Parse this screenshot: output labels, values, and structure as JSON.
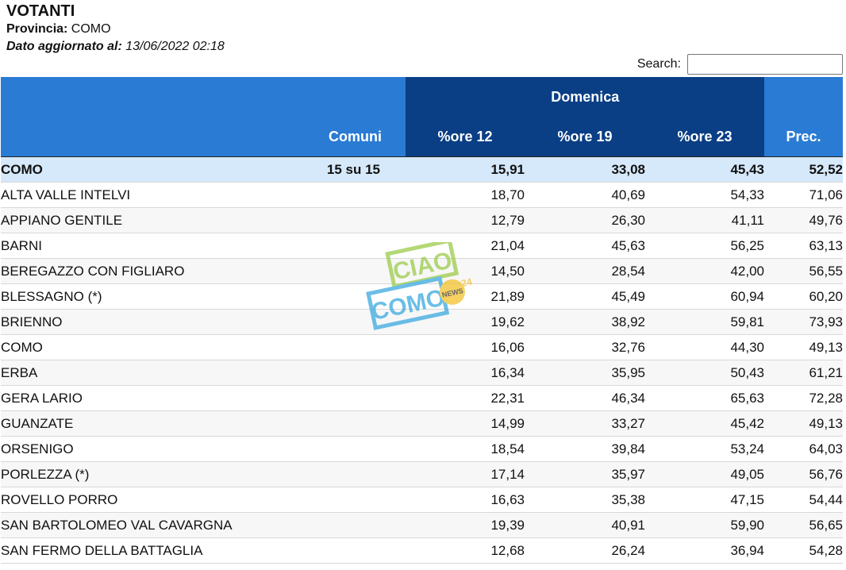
{
  "header": {
    "title": "VOTANTI",
    "provincia_label": "Provincia:",
    "provincia_value": " COMO",
    "aggiornato_label": "Dato aggiornato al:",
    "aggiornato_value": " 13/06/2022 02:18"
  },
  "search": {
    "label": "Search:",
    "value": ""
  },
  "table": {
    "group_header": "Domenica",
    "columns": {
      "comuni": "Comuni",
      "ore12": "%ore 12",
      "ore19": "%ore 19",
      "ore23": "%ore 23",
      "prec": "Prec."
    },
    "total": {
      "name": "COMO",
      "sezioni": "15 su 15",
      "ore12": "15,91",
      "ore19": "33,08",
      "ore23": "45,43",
      "prec": "52,52"
    },
    "rows": [
      {
        "name": "ALTA VALLE INTELVI",
        "ore12": "18,70",
        "ore19": "40,69",
        "ore23": "54,33",
        "prec": "71,06"
      },
      {
        "name": "APPIANO GENTILE",
        "ore12": "12,79",
        "ore19": "26,30",
        "ore23": "41,11",
        "prec": "49,76"
      },
      {
        "name": "BARNI",
        "ore12": "21,04",
        "ore19": "45,63",
        "ore23": "56,25",
        "prec": "63,13"
      },
      {
        "name": "BEREGAZZO CON FIGLIARO",
        "ore12": "14,50",
        "ore19": "28,54",
        "ore23": "42,00",
        "prec": "56,55"
      },
      {
        "name": "BLESSAGNO (*)",
        "ore12": "21,89",
        "ore19": "45,49",
        "ore23": "60,94",
        "prec": "60,20"
      },
      {
        "name": "BRIENNO",
        "ore12": "19,62",
        "ore19": "38,92",
        "ore23": "59,81",
        "prec": "73,93"
      },
      {
        "name": "COMO",
        "ore12": "16,06",
        "ore19": "32,76",
        "ore23": "44,30",
        "prec": "49,13"
      },
      {
        "name": "ERBA",
        "ore12": "16,34",
        "ore19": "35,95",
        "ore23": "50,43",
        "prec": "61,21"
      },
      {
        "name": "GERA LARIO",
        "ore12": "22,31",
        "ore19": "46,34",
        "ore23": "65,63",
        "prec": "72,28"
      },
      {
        "name": "GUANZATE",
        "ore12": "14,99",
        "ore19": "33,27",
        "ore23": "45,42",
        "prec": "49,13"
      },
      {
        "name": "ORSENIGO",
        "ore12": "18,54",
        "ore19": "39,84",
        "ore23": "53,24",
        "prec": "64,03"
      },
      {
        "name": "PORLEZZA (*)",
        "ore12": "17,14",
        "ore19": "35,97",
        "ore23": "49,05",
        "prec": "56,76"
      },
      {
        "name": "ROVELLO PORRO",
        "ore12": "16,63",
        "ore19": "35,38",
        "ore23": "47,15",
        "prec": "54,44"
      },
      {
        "name": "SAN BARTOLOMEO VAL CAVARGNA",
        "ore12": "19,39",
        "ore19": "40,91",
        "ore23": "59,90",
        "prec": "56,65"
      },
      {
        "name": "SAN FERMO DELLA BATTAGLIA",
        "ore12": "12,68",
        "ore19": "26,24",
        "ore23": "36,94",
        "prec": "54,28"
      }
    ]
  },
  "watermark": {
    "line1": "CIAO",
    "line2": "COMO",
    "badge": "NEWS",
    "badge_num": "24"
  },
  "colors": {
    "header_blue": "#2a7bd4",
    "header_dark": "#0a3f85",
    "total_row": "#d6e9fb"
  }
}
